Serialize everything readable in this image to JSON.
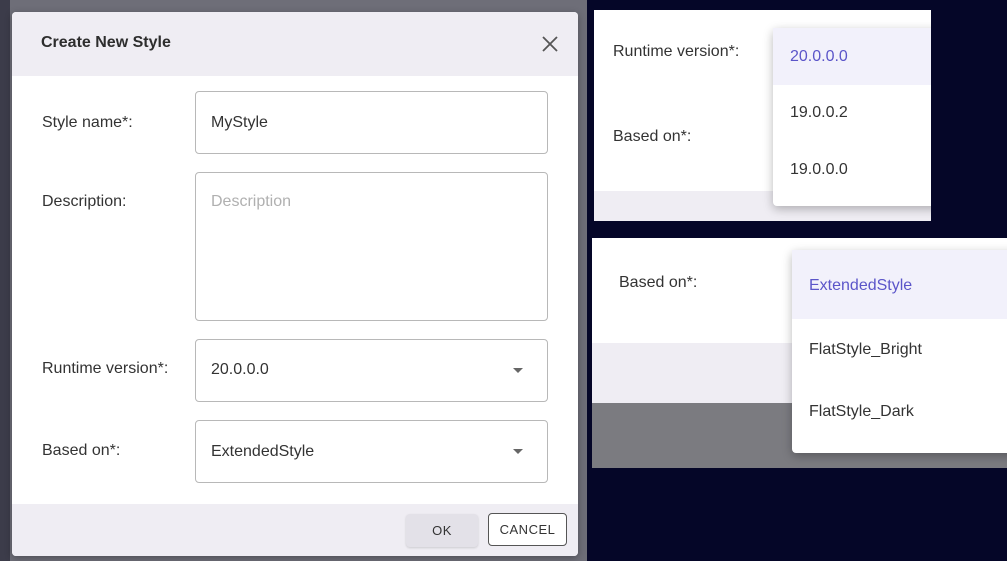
{
  "dialog": {
    "title": "Create New Style",
    "fields": {
      "style_name": {
        "label": "Style name*:",
        "value": "MyStyle"
      },
      "description": {
        "label": "Description:",
        "placeholder": "Description",
        "value": ""
      },
      "runtime_version": {
        "label": "Runtime version*:",
        "value": "20.0.0.0"
      },
      "based_on": {
        "label": "Based on*:",
        "value": "ExtendedStyle"
      }
    },
    "buttons": {
      "ok": "OK",
      "cancel": "CANCEL"
    }
  },
  "runtime_dropdown_panel": {
    "labels": {
      "runtime_version": "Runtime version*:",
      "based_on": "Based on*:"
    },
    "options": [
      "20.0.0.0",
      "19.0.0.2",
      "19.0.0.0"
    ],
    "selected": "20.0.0.0"
  },
  "based_on_dropdown_panel": {
    "label": "Based on*:",
    "options": [
      "ExtendedStyle",
      "FlatStyle_Bright",
      "FlatStyle_Dark"
    ],
    "selected": "ExtendedStyle"
  },
  "colors": {
    "accent": "#5b55c9",
    "header_bg": "#efedf3",
    "page_bg": "#050628"
  },
  "icons": {
    "close": "close-icon",
    "dropdown": "chevron-down-icon"
  }
}
